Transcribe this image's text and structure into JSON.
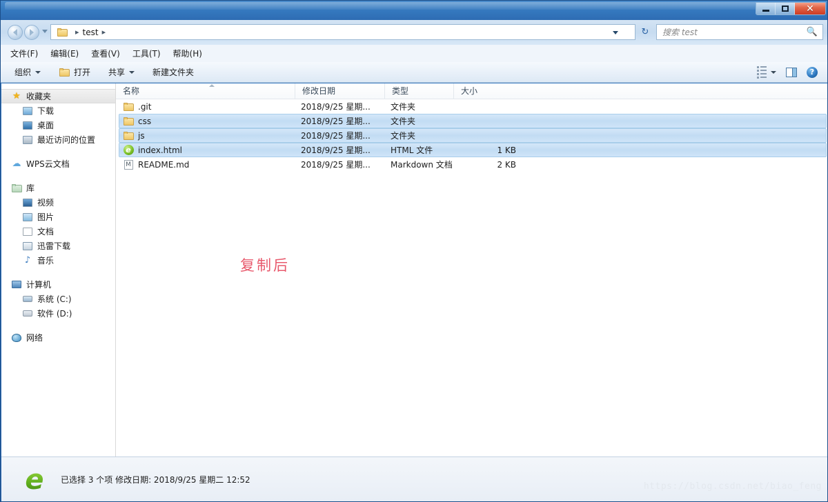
{
  "window": {
    "controls": {
      "minimize": "minimize-icon",
      "maximize": "maximize-icon",
      "close": "✕"
    }
  },
  "navbar": {
    "back_icon": "back-arrow-icon",
    "forward_icon": "forward-arrow-icon",
    "recent_icon": "recent-pages-icon",
    "folder_icon": "folder-icon",
    "crumb_sep_1": "▸",
    "crumb_text": "test",
    "crumb_sep_2": "▸",
    "dropdown_icon": "chevron-down-icon",
    "refresh_icon": "↻",
    "search_placeholder": "搜索 test",
    "search_value": "",
    "search_icon": "search-icon"
  },
  "menubar": {
    "items": [
      {
        "label": "文件(F)"
      },
      {
        "label": "编辑(E)"
      },
      {
        "label": "查看(V)"
      },
      {
        "label": "工具(T)"
      },
      {
        "label": "帮助(H)"
      }
    ]
  },
  "commandbar": {
    "organize_label": "组织",
    "open_label": "打开",
    "share_label": "共享",
    "newfolder_label": "新建文件夹",
    "view_icon": "view-mode-icon",
    "preview_icon": "preview-pane-icon",
    "help_icon": "?"
  },
  "sidebar": {
    "groups": [
      {
        "root": {
          "label": "收藏夹",
          "icon": "star-icon",
          "selected": true
        },
        "children": [
          {
            "label": "下载",
            "icon": "downloads-icon"
          },
          {
            "label": "桌面",
            "icon": "desktop-icon"
          },
          {
            "label": "最近访问的位置",
            "icon": "recent-places-icon"
          }
        ]
      },
      {
        "root": {
          "label": "WPS云文档",
          "icon": "cloud-icon",
          "selected": false
        },
        "children": []
      },
      {
        "root": {
          "label": "库",
          "icon": "library-icon",
          "selected": false
        },
        "children": [
          {
            "label": "视频",
            "icon": "video-icon"
          },
          {
            "label": "图片",
            "icon": "picture-icon"
          },
          {
            "label": "文档",
            "icon": "document-icon"
          },
          {
            "label": "迅雷下载",
            "icon": "thunder-download-icon"
          },
          {
            "label": "音乐",
            "icon": "music-icon"
          }
        ]
      },
      {
        "root": {
          "label": "计算机",
          "icon": "computer-icon",
          "selected": false
        },
        "children": [
          {
            "label": "系统 (C:)",
            "icon": "system-drive-icon"
          },
          {
            "label": "软件 (D:)",
            "icon": "drive-icon"
          }
        ]
      },
      {
        "root": {
          "label": "网络",
          "icon": "network-icon",
          "selected": false
        },
        "children": []
      }
    ]
  },
  "filelist": {
    "columns": [
      {
        "key": "name",
        "label": "名称"
      },
      {
        "key": "date",
        "label": "修改日期"
      },
      {
        "key": "type",
        "label": "类型"
      },
      {
        "key": "size",
        "label": "大小"
      }
    ],
    "sort_indicator": "ascending",
    "rows": [
      {
        "name": ".git",
        "date": "2018/9/25 星期...",
        "type": "文件夹",
        "size": "",
        "icon": "folder-icon",
        "selected": false
      },
      {
        "name": "css",
        "date": "2018/9/25 星期...",
        "type": "文件夹",
        "size": "",
        "icon": "folder-icon",
        "selected": true
      },
      {
        "name": "js",
        "date": "2018/9/25 星期...",
        "type": "文件夹",
        "size": "",
        "icon": "folder-icon",
        "selected": true
      },
      {
        "name": "index.html",
        "date": "2018/9/25 星期...",
        "type": "HTML 文件",
        "size": "1 KB",
        "icon": "ie-html-icon",
        "selected": true
      },
      {
        "name": "README.md",
        "date": "2018/9/25 星期...",
        "type": "Markdown 文档",
        "size": "2 KB",
        "icon": "markdown-icon",
        "selected": false
      }
    ]
  },
  "annotation": {
    "text": "复制后",
    "color": "#e8596c"
  },
  "statusbar": {
    "icon": "ie-browser-icon",
    "text": "已选择 3 个项  修改日期: 2018/9/25 星期二 12:52"
  },
  "watermark": {
    "text": "https://blog.csdn.net/biao_feng"
  }
}
